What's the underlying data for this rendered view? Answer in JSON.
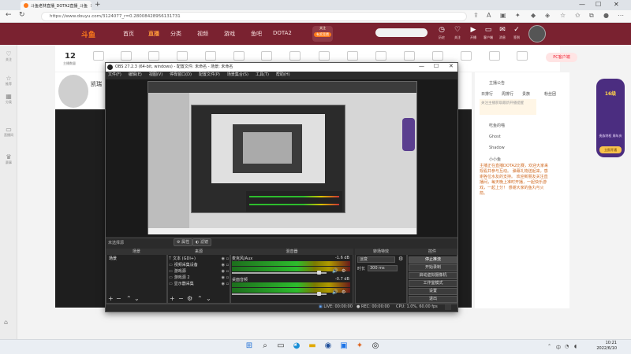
{
  "browser": {
    "tab_title": "斗鱼老林直播_DOTA2直播_斗鱼",
    "tab_close": "×",
    "new_tab": "+",
    "url": "https://www.douyu.com/3124077_r=0.28008428956131731",
    "min": "—",
    "max": "☐",
    "close": "✕"
  },
  "site": {
    "logo": "斗鱼",
    "nav": [
      "首页",
      "直播",
      "分类",
      "视频",
      "游戏",
      "鱼吧",
      "DOTA2"
    ],
    "follow_label": "关注",
    "follow_sub": "有奖竞猜",
    "header_icons": [
      "历史",
      "关注",
      "开播",
      "客户端",
      "消息",
      "签到"
    ],
    "left_items": [
      "关注",
      "推荐",
      "分类",
      "直播间",
      "赛事"
    ],
    "count": "12",
    "count_label": "主播数量",
    "pc_button": "PC客户端",
    "streamer_name": "凯瑞",
    "right_title": "主播公告",
    "right_tabs": [
      "日排行",
      "周排行",
      "贵族",
      "粉丝团"
    ],
    "right_tip": "关注主播获取最新开播提醒",
    "ranks": [
      "吃鱼的喵",
      "Ghost",
      "Shadow",
      "小小鱼"
    ],
    "chat": "主播正在直播DOTA2比赛，欢迎大家来观看并参与互动。 弹幕礼物送起来，感谢各位水友的支持。 欢迎新朋友关注直播间，每天晚上准时开播，一起快乐游戏，一起上分！ 感谢大家的鱼丸与火箭。",
    "badge_top": "16级",
    "badge_mid": "贵族特权 周年庆",
    "badge_btn": "立即开通"
  },
  "obs": {
    "title": "OBS 27.2.3 (64-bit, windows) - 配置文件: 未命名 - 场景: 未命名",
    "menu": [
      "文件(F)",
      "编辑(E)",
      "视图(V)",
      "停靠窗口(D)",
      "配置文件(P)",
      "场景集合(S)",
      "工具(T)",
      "帮助(H)"
    ],
    "no_scene": "未选择源",
    "props": "属性",
    "filters": "滤镜",
    "docks": [
      "场景",
      "来源",
      "混音器",
      "转场特效",
      "控件"
    ],
    "scene": "场景",
    "sources": [
      {
        "icon": "T",
        "name": "文本 (GDI+)"
      },
      {
        "icon": "▭",
        "name": "视频采集设备"
      },
      {
        "icon": "▭",
        "name": "游戏源"
      },
      {
        "icon": "▭",
        "name": "游戏源 2"
      },
      {
        "icon": "▭",
        "name": "显示器采集"
      }
    ],
    "mixer": [
      {
        "name": "麦克风/Aux",
        "db": "-1.6 dB"
      },
      {
        "name": "桌面音频",
        "db": "-0.7 dB"
      }
    ],
    "transition": "淡变",
    "duration_label": "时长",
    "duration": "300 ms",
    "controls": [
      "停止推流",
      "开始录制",
      "启动虚拟摄像机",
      "工作室模式",
      "设置",
      "退出"
    ],
    "status": {
      "live": "LIVE: 00:00:00",
      "rec": "REC: 00:00:00",
      "cpu": "CPU: 1.0%, 60.00 fps"
    }
  },
  "taskbar": {
    "time": "10:21",
    "date": "2022/6/10",
    "tray": "中"
  },
  "colors": {
    "header": "#7a2230",
    "accent": "#ff7a1a",
    "obs_bg": "#2b2b2b"
  }
}
